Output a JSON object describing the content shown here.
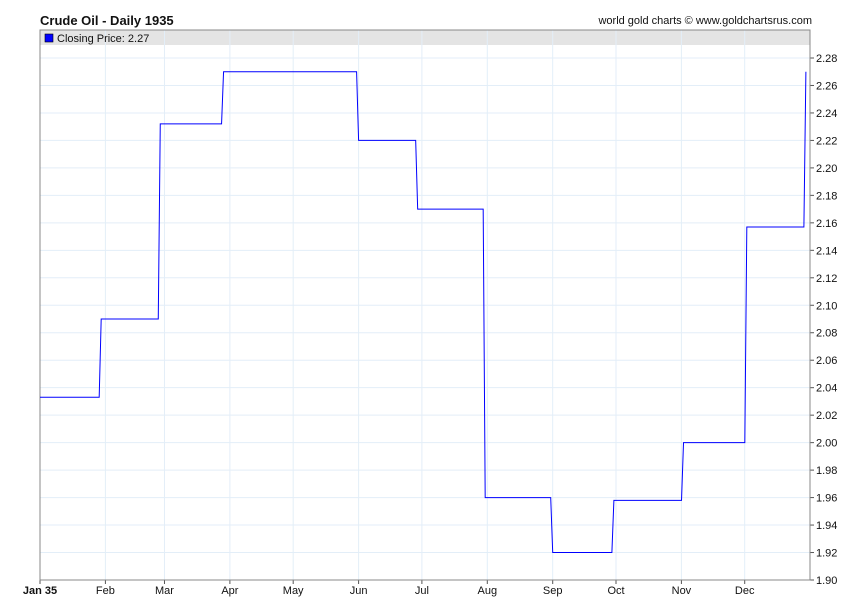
{
  "chart_data": {
    "type": "line",
    "title": "Crude Oil - Daily 1935",
    "credit": "world gold charts © www.goldchartsrus.com",
    "legend": {
      "label": "Closing Price: 2.27",
      "color": "#0000ff",
      "placement": "top-left"
    },
    "xlabel": "",
    "ylabel": "",
    "x_ticks": [
      {
        "label": "Jan 35",
        "day": 0
      },
      {
        "label": "Feb",
        "day": 31
      },
      {
        "label": "Mar",
        "day": 59
      },
      {
        "label": "Apr",
        "day": 90
      },
      {
        "label": "May",
        "day": 120
      },
      {
        "label": "Jun",
        "day": 151
      },
      {
        "label": "Jul",
        "day": 181
      },
      {
        "label": "Aug",
        "day": 212
      },
      {
        "label": "Sep",
        "day": 243
      },
      {
        "label": "Oct",
        "day": 273
      },
      {
        "label": "Nov",
        "day": 304
      },
      {
        "label": "Dec",
        "day": 334
      }
    ],
    "xlim": [
      0,
      365
    ],
    "ylim": [
      1.9,
      2.28
    ],
    "y_ticks": [
      "2.28",
      "2.26",
      "2.24",
      "2.22",
      "2.20",
      "2.18",
      "2.16",
      "2.14",
      "2.12",
      "2.10",
      "2.08",
      "2.06",
      "2.04",
      "2.02",
      "2.00",
      "1.98",
      "1.96",
      "1.94",
      "1.92",
      "1.90"
    ],
    "grid": true,
    "series": [
      {
        "name": "Closing Price",
        "color": "#0000ff",
        "step": true,
        "points": [
          [
            0,
            2.033
          ],
          [
            29,
            2.09
          ],
          [
            57,
            2.232
          ],
          [
            87,
            2.27
          ],
          [
            151,
            2.22
          ],
          [
            179,
            2.17
          ],
          [
            211,
            1.96
          ],
          [
            243,
            1.92
          ],
          [
            272,
            1.958
          ],
          [
            305,
            2.0
          ],
          [
            335,
            2.157
          ],
          [
            363,
            2.27
          ]
        ]
      }
    ]
  }
}
